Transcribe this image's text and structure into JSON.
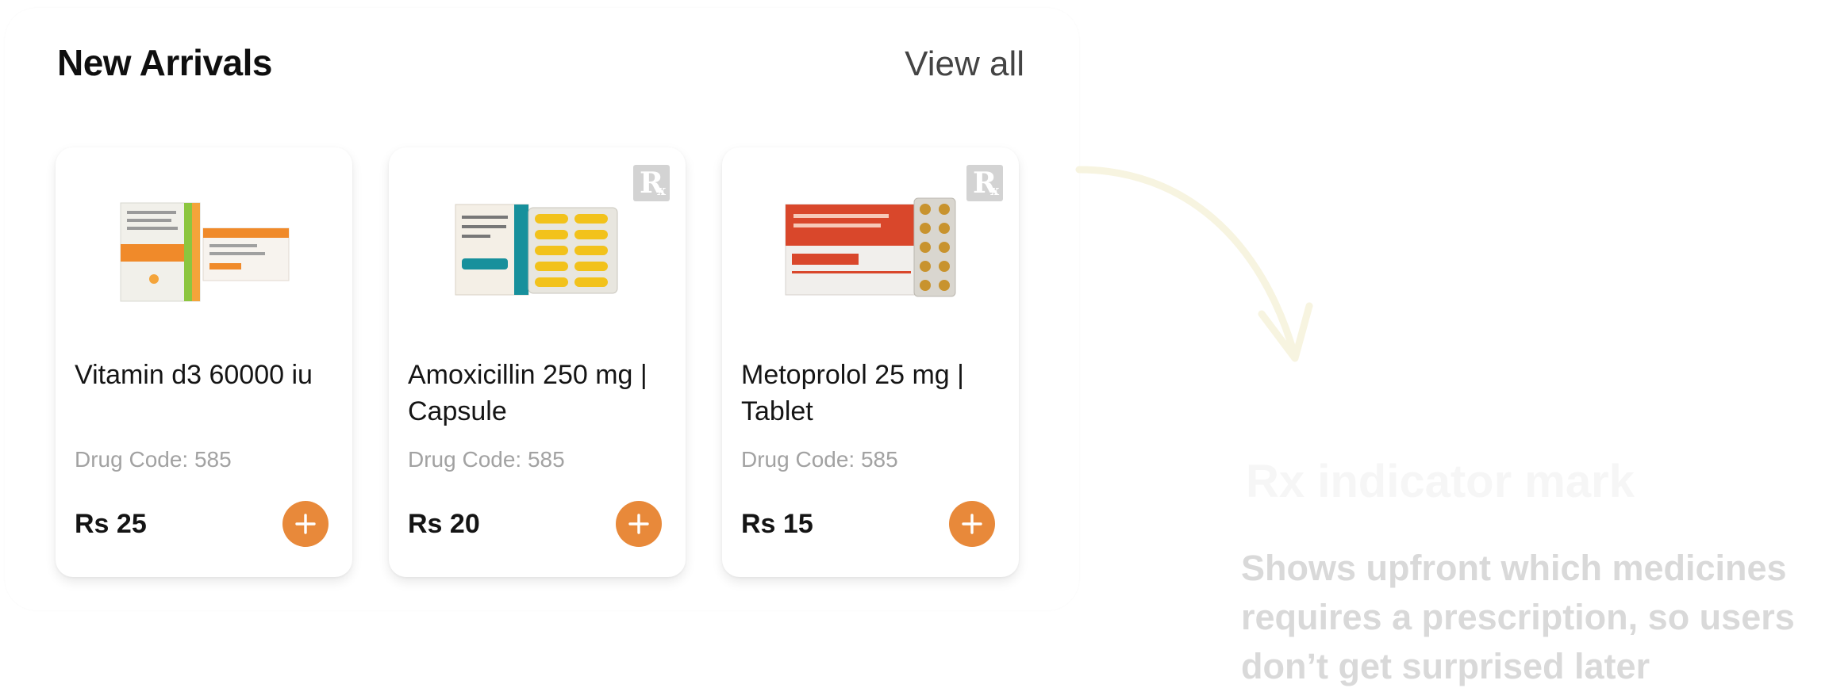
{
  "section": {
    "title": "New Arrivals",
    "view_all": "View all"
  },
  "products": [
    {
      "name": "Vitamin d3 60000 iu",
      "drug_code": "Drug Code: 585",
      "price": "Rs 25",
      "rx": false
    },
    {
      "name": "Amoxicillin 250 mg | Capsule",
      "drug_code": "Drug Code: 585",
      "price": "Rs 20",
      "rx": true
    },
    {
      "name": "Metoprolol 25 mg | Tablet",
      "drug_code": "Drug Code: 585",
      "price": "Rs 15",
      "rx": true
    }
  ],
  "rx_badge": {
    "glyph": "R",
    "sub": "x"
  },
  "annotation": {
    "title": "Rx indicator mark",
    "body_lines": [
      "Shows upfront which medicines",
      "requires a prescription, so users",
      "don’t get surprised later"
    ]
  },
  "colors": {
    "accent": "#e8893a",
    "badge": "#d3d3d3",
    "muted_text": "#a2a2a2"
  },
  "icons": {
    "add": "plus-icon",
    "rx": "rx-icon",
    "arrow": "curved-arrow-icon"
  }
}
